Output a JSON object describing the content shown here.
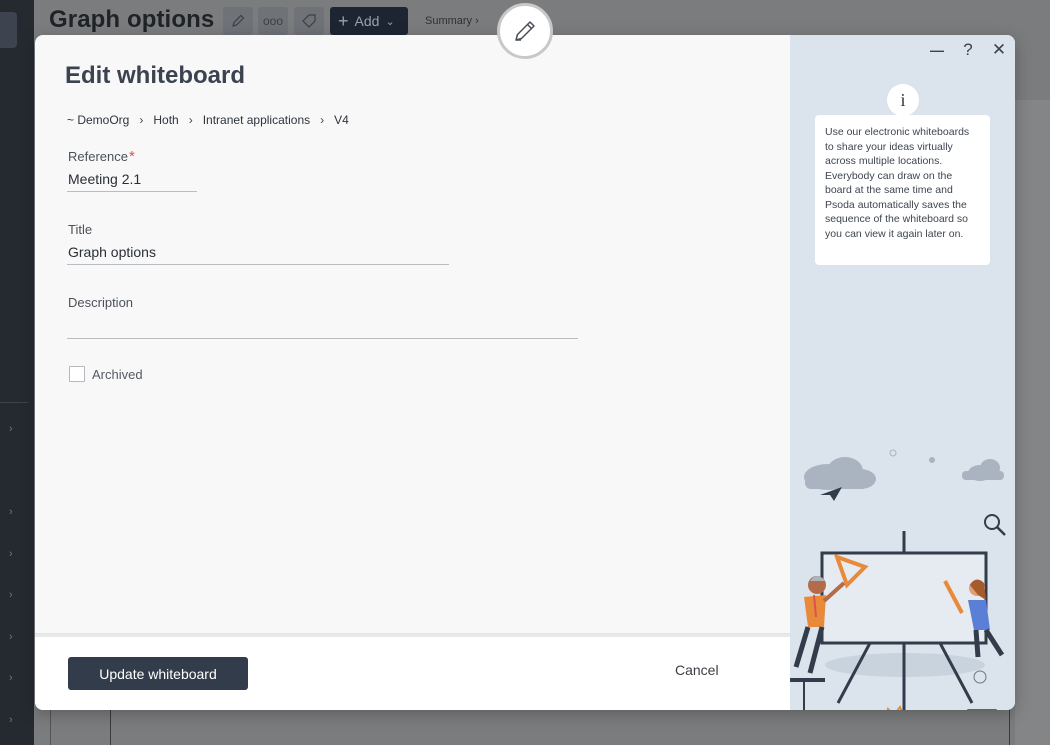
{
  "app": {
    "page_title": "Graph options",
    "toolbar": {
      "add_label": "Add",
      "more_label": "ooo",
      "summary_label": "Summary ›"
    }
  },
  "modal": {
    "title": "Edit whiteboard",
    "breadcrumb": [
      "~ DemoOrg",
      "Hoth",
      "Intranet applications",
      "V4"
    ],
    "breadcrumb_separator": "›",
    "fields": {
      "reference": {
        "label": "Reference",
        "value": "Meeting 2.1",
        "required_mark": "*"
      },
      "title": {
        "label": "Title",
        "value": "Graph options"
      },
      "description": {
        "label": "Description",
        "value": ""
      }
    },
    "archived_label": "Archived",
    "archived_checked": false,
    "update_button": "Update whiteboard",
    "cancel_button": "Cancel",
    "window_controls": {
      "minimize": "—",
      "help": "?",
      "close": "✕"
    },
    "info": {
      "icon_glyph": "i",
      "text": "Use our electronic whiteboards to share your ideas virtually across multiple locations. Everybody can draw on the board at the same time and Psoda automatically saves the sequence of the whiteboard so you can view it again later on."
    }
  },
  "colors": {
    "primary_button": "#323c4b",
    "required": "#d9534f",
    "side_panel": "#dbe3ec",
    "sidebar": "#252a31",
    "accent_orange": "#e98a3a",
    "accent_blue": "#5b7fd6"
  }
}
